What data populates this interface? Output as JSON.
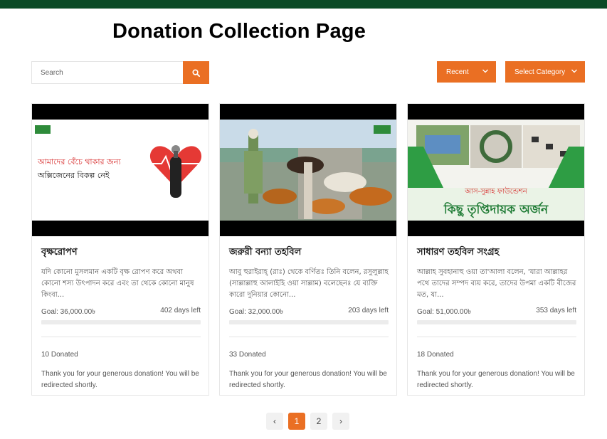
{
  "header": {
    "title": "Donation Collection Page"
  },
  "search": {
    "placeholder": "Search",
    "icon": "search-icon"
  },
  "filters": {
    "sort_label": "Recent",
    "category_label": "Select Category"
  },
  "colors": {
    "accent": "#ea6f23",
    "topbar": "#0b4a26"
  },
  "cards": [
    {
      "title": "বৃক্ষরোপণ",
      "description": "যদি কোনো মুসলমান একটি বৃক্ষ রোপণ করে অথবা কোনো শস্য উৎপাদন করে এবং তা থেকে কোনো মানুষ কিংবা...",
      "goal": "Goal: 36,000.00৳",
      "days_left": "402 days left",
      "progress": 0,
      "donated": "10 Donated",
      "thanks": "Thank you for your generous donation! You will be redirected shortly.",
      "banner_text_1": "আমাদের বেঁচে থাকার জন্য",
      "banner_text_2": "অক্সিজেনের বিকল্প নেই"
    },
    {
      "title": "জরুরী বন্যা তহবিল",
      "description": "আবু হুরাইরাহ্ (রাঃ) থেকে বর্ণিতঃ তিনি বলেন, রসুলুল্লাহ (সাল্লাল্লাহু আলাইহি ওয়া সাল্লাম) বলেছেনঃ যে ব্যক্তি কারো দুনিয়ার কোনো...",
      "goal": "Goal: 32,000.00৳",
      "days_left": "203 days left",
      "progress": 0,
      "donated": "33 Donated",
      "thanks": "Thank you for your generous donation! You will be redirected shortly."
    },
    {
      "title": "সাধারণ তহবিল সংগ্রহ",
      "description": "আল্লাহ সুবহানাহু ওয়া তা'আলা বলেন, 'যারা আল্লাহর পথে তাদের সম্পদ ব্যয় করে, তাদের উপমা একটি বীজের মত, যা...",
      "goal": "Goal: 51,000.00৳",
      "days_left": "353 days left",
      "progress": 0,
      "donated": "18 Donated",
      "thanks": "Thank you for your generous donation! You will be redirected shortly.",
      "banner_text_1": "আস-সুন্নাহ ফাউন্ডেশন",
      "banner_text_2": "কিছু তৃপ্তিদায়ক অর্জন"
    }
  ],
  "pagination": {
    "prev": "‹",
    "pages": [
      "1",
      "2"
    ],
    "next": "›",
    "current": "1"
  }
}
